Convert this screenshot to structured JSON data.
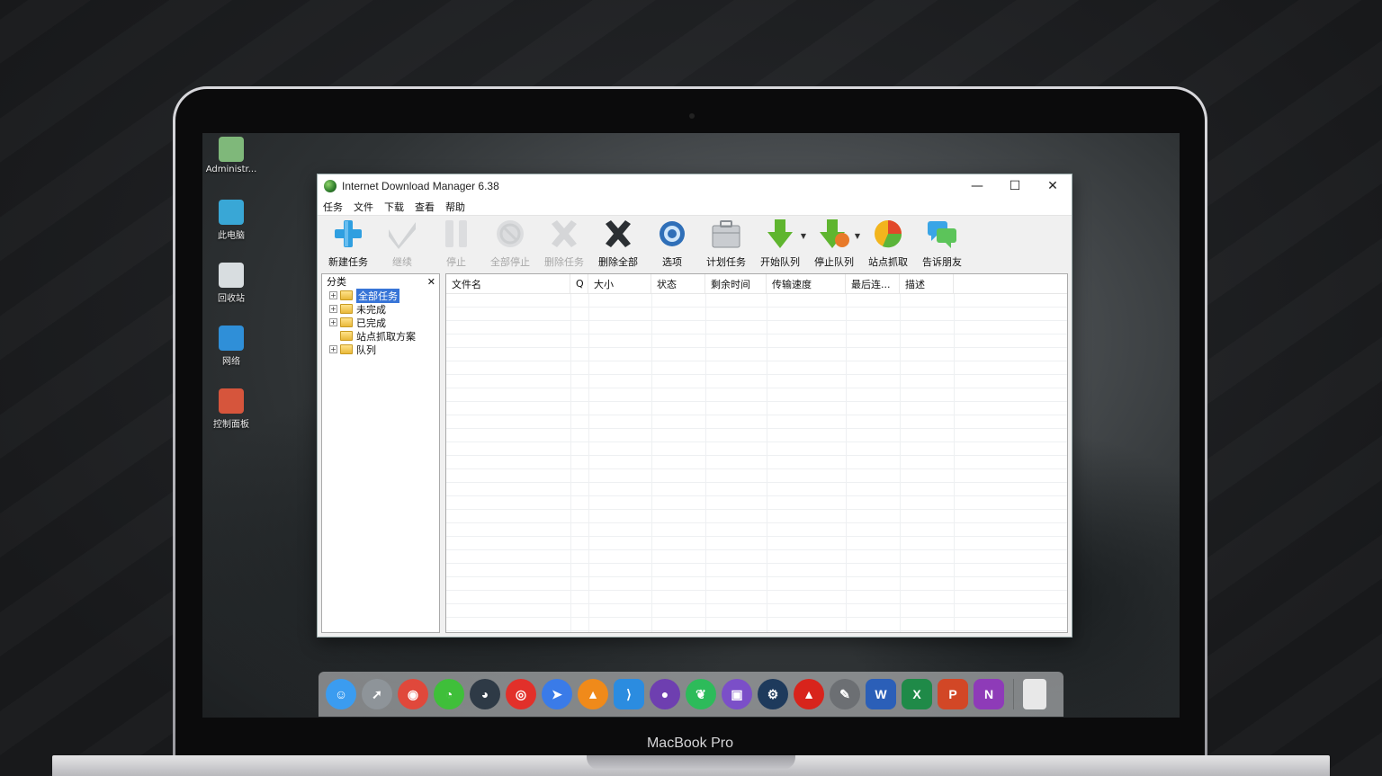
{
  "device": {
    "label": "MacBook Pro"
  },
  "desktop": {
    "icons": [
      {
        "label": "Administr...",
        "icon": "user-folder-icon",
        "color": "#7fb87a"
      },
      {
        "label": "此电脑",
        "icon": "computer-icon",
        "color": "#39a7d6"
      },
      {
        "label": "回收站",
        "icon": "recycle-bin-icon",
        "color": "#d8dde0"
      },
      {
        "label": "网络",
        "icon": "network-globe-icon",
        "color": "#2f8fd8"
      },
      {
        "label": "控制面板",
        "icon": "control-panel-icon",
        "color": "#d6553c"
      }
    ]
  },
  "window": {
    "title": "Internet Download Manager 6.38",
    "controls": {
      "minimize": "—",
      "maximize": "☐",
      "close": "✕"
    },
    "menu": [
      "任务",
      "文件",
      "下载",
      "查看",
      "帮助"
    ],
    "toolbar": [
      {
        "label": "新建任务",
        "icon": "add-plus-icon",
        "enabled": true
      },
      {
        "label": "继续",
        "icon": "resume-check-icon",
        "enabled": false
      },
      {
        "label": "停止",
        "icon": "pause-icon",
        "enabled": false
      },
      {
        "label": "全部停止",
        "icon": "stop-all-icon",
        "enabled": false
      },
      {
        "label": "删除任务",
        "icon": "delete-x-icon",
        "enabled": false
      },
      {
        "label": "删除全部",
        "icon": "delete-all-x-icon",
        "enabled": true
      },
      {
        "label": "选项",
        "icon": "gear-icon",
        "enabled": true
      },
      {
        "label": "计划任务",
        "icon": "scheduler-briefcase-icon",
        "enabled": true
      },
      {
        "label": "开始队列",
        "icon": "start-queue-arrow-icon",
        "enabled": true,
        "dropdown": true
      },
      {
        "label": "停止队列",
        "icon": "stop-queue-arrow-icon",
        "enabled": true,
        "dropdown": true
      },
      {
        "label": "站点抓取",
        "icon": "site-grabber-pie-icon",
        "enabled": true
      },
      {
        "label": "告诉朋友",
        "icon": "tell-friend-chat-icon",
        "enabled": true
      }
    ],
    "category_panel": {
      "header": "分类",
      "close": "✕",
      "tree": [
        {
          "label": "全部任务",
          "expander": "⊞",
          "selected": true
        },
        {
          "label": "未完成",
          "expander": "⊞",
          "selected": false
        },
        {
          "label": "已完成",
          "expander": "⊞",
          "selected": false
        },
        {
          "label": "站点抓取方案",
          "expander": "",
          "selected": false
        },
        {
          "label": "队列",
          "expander": "⊞",
          "selected": false
        }
      ]
    },
    "list": {
      "columns": [
        "文件名",
        "Q",
        "大小",
        "状态",
        "剩余时间",
        "传输速度",
        "最后连...",
        "描述"
      ],
      "rows": []
    }
  },
  "dock": {
    "apps": [
      {
        "name": "finder-icon",
        "color": "#3b9cf0",
        "glyph": "☺"
      },
      {
        "name": "launchpad-rocket-icon",
        "color": "#8e9499",
        "glyph": "➚"
      },
      {
        "name": "chrome-icon",
        "color": "#e0483b",
        "glyph": "◉"
      },
      {
        "name": "wechat-icon",
        "color": "#3fbf3a",
        "glyph": "◔"
      },
      {
        "name": "qq-penguin-icon",
        "color": "#2e3a46",
        "glyph": "◕"
      },
      {
        "name": "netease-music-icon",
        "color": "#e2302a",
        "glyph": "◎"
      },
      {
        "name": "feishu-bird-icon",
        "color": "#3a7be8",
        "glyph": "➤"
      },
      {
        "name": "vlc-cone-icon",
        "color": "#f08a1a",
        "glyph": "▲"
      },
      {
        "name": "vscode-icon",
        "color": "#2b8ce0",
        "glyph": "⟩"
      },
      {
        "name": "github-icon",
        "color": "#6e3fb0",
        "glyph": "●"
      },
      {
        "name": "evernote-icon",
        "color": "#2dbb5a",
        "glyph": "❦"
      },
      {
        "name": "twitch-icon",
        "color": "#7b4fc8",
        "glyph": "▣"
      },
      {
        "name": "steam-icon",
        "color": "#1e3a5c",
        "glyph": "⚙"
      },
      {
        "name": "acrobat-icon",
        "color": "#d8241c",
        "glyph": "▲"
      },
      {
        "name": "pen-tool-icon",
        "color": "#6c6f73",
        "glyph": "✎"
      },
      {
        "name": "word-icon",
        "color": "#2b5fb8",
        "glyph": "W"
      },
      {
        "name": "excel-icon",
        "color": "#1f8a48",
        "glyph": "X"
      },
      {
        "name": "powerpoint-icon",
        "color": "#d24726",
        "glyph": "P"
      },
      {
        "name": "onenote-icon",
        "color": "#8e3bb8",
        "glyph": "N"
      }
    ],
    "trash": {
      "name": "trash-icon",
      "color": "#e8e8e8"
    }
  }
}
